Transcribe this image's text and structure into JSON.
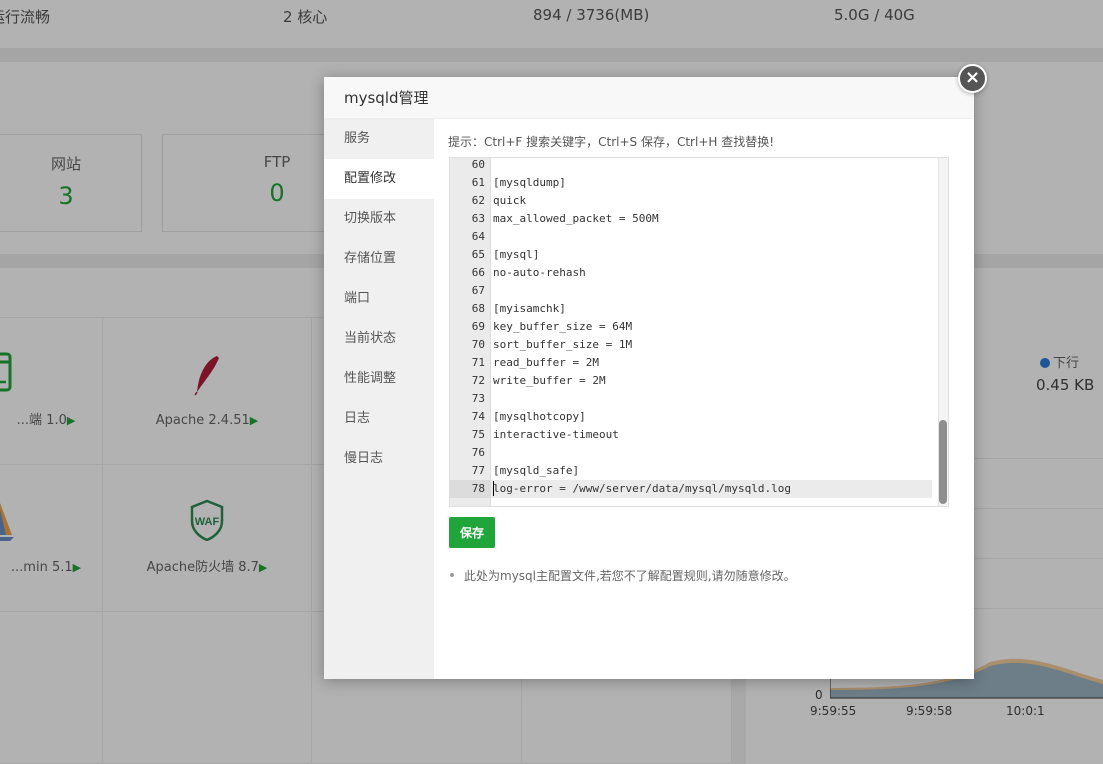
{
  "topbar": {
    "status": "运行流畅",
    "cpu": "2 核心",
    "memory": "894 / 3736(MB)",
    "disk": "5.0G / 40G"
  },
  "stats": [
    {
      "label": "网站",
      "value": "3"
    },
    {
      "label": "FTP",
      "value": "0"
    }
  ],
  "software": [
    {
      "name": "...端 1.0",
      "icon": "green-window-icon"
    },
    {
      "name": "Apache 2.4.51",
      "icon": "apache-feather-icon"
    },
    {
      "name": "...min 5.1",
      "icon": "phpmyadmin-sail-icon"
    },
    {
      "name": "Apache防火墙 8.7",
      "icon": "waf-shield-icon"
    }
  ],
  "traffic": {
    "legend": "下行",
    "value": "0.45 KB",
    "y_zero": "0",
    "x_ticks": [
      "9:59:55",
      "9:59:58",
      "10:0:1"
    ],
    "colors": {
      "down": "#2d7bd6",
      "up": "#f0a64a"
    }
  },
  "modal": {
    "title": "mysqld管理",
    "close_icon": "×",
    "menu": [
      "服务",
      "配置修改",
      "切换版本",
      "存储位置",
      "端口",
      "当前状态",
      "性能调整",
      "日志",
      "慢日志"
    ],
    "active_menu": "配置修改",
    "tip": "提示：Ctrl+F 搜索关键字，Ctrl+S 保存，Ctrl+H 查找替换!",
    "editor_lines": [
      {
        "n": "60",
        "code": ""
      },
      {
        "n": "61",
        "code": "[mysqldump]"
      },
      {
        "n": "62",
        "code": "quick"
      },
      {
        "n": "63",
        "code": "max_allowed_packet = 500M"
      },
      {
        "n": "64",
        "code": ""
      },
      {
        "n": "65",
        "code": "[mysql]"
      },
      {
        "n": "66",
        "code": "no-auto-rehash"
      },
      {
        "n": "67",
        "code": ""
      },
      {
        "n": "68",
        "code": "[myisamchk]"
      },
      {
        "n": "69",
        "code": "key_buffer_size = 64M"
      },
      {
        "n": "70",
        "code": "sort_buffer_size = 1M"
      },
      {
        "n": "71",
        "code": "read_buffer = 2M"
      },
      {
        "n": "72",
        "code": "write_buffer = 2M"
      },
      {
        "n": "73",
        "code": ""
      },
      {
        "n": "74",
        "code": "[mysqlhotcopy]"
      },
      {
        "n": "75",
        "code": "interactive-timeout"
      },
      {
        "n": "76",
        "code": ""
      },
      {
        "n": "77",
        "code": "[mysqld_safe]"
      },
      {
        "n": "78",
        "code": "log-error = /www/server/data/mysql/mysqld.log"
      }
    ],
    "current_line": "78",
    "save_label": "保存",
    "note": "此处为mysql主配置文件,若您不了解配置规则,请勿随意修改。"
  },
  "colors": {
    "accent": "#20a53a",
    "overlay": "rgba(0,0,0,0.3)"
  }
}
